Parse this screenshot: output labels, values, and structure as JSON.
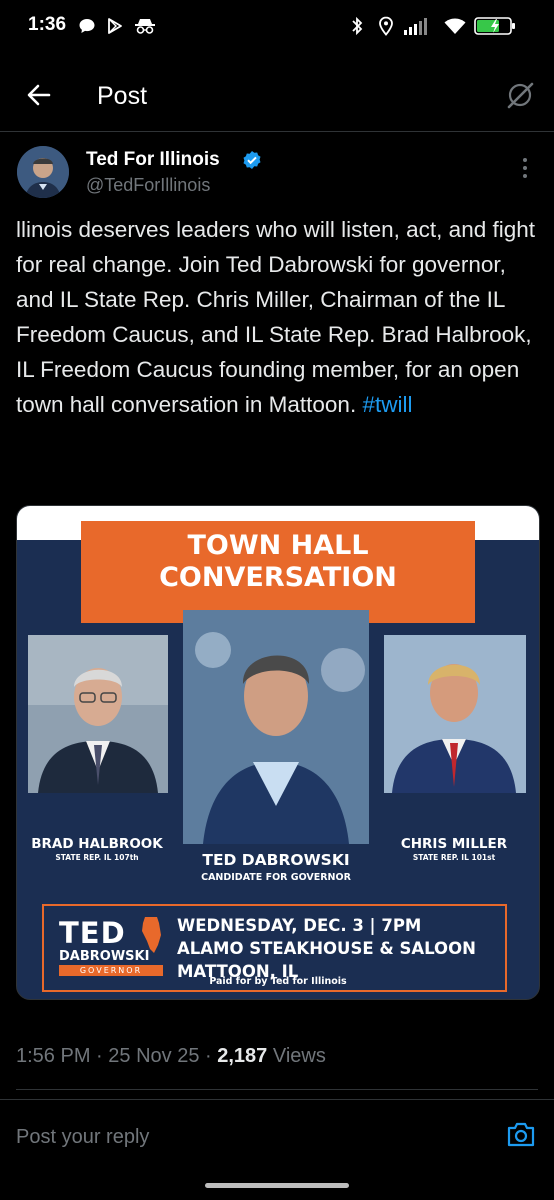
{
  "status_bar": {
    "time": "1:36",
    "left_icons": [
      "chat-bubble-icon",
      "play-store-icon",
      "incognito-icon"
    ],
    "right_icons": [
      "bluetooth-icon",
      "location-icon",
      "signal-icon",
      "wifi-icon",
      "battery-charging-icon"
    ]
  },
  "header": {
    "title": "Post"
  },
  "author": {
    "name": "Ted For Illinois",
    "handle": "@TedForIllinois",
    "verified": true
  },
  "post": {
    "text": "llinois deserves leaders who will listen, act, and fight for real change. Join Ted Dabrowski for governor, and IL State Rep. Chris Miller, Chairman of the IL Freedom Caucus, and IL State Rep. Brad Halbrook, IL Freedom Caucus founding member, for an open town hall conversation in Mattoon.",
    "hashtag": "#twill"
  },
  "flyer": {
    "banner_line1": "TOWN HALL",
    "banner_line2": "CONVERSATION",
    "people": [
      {
        "name": "BRAD HALBROOK",
        "title": "STATE REP.  IL 107th"
      },
      {
        "name": "TED DABROWSKI",
        "title": "CANDIDATE FOR GOVERNOR"
      },
      {
        "name": "CHRIS MILLER",
        "title": "STATE REP.  IL 101st"
      }
    ],
    "logo_ted": "TED",
    "logo_dabrowski": "DABROWSKI",
    "logo_governor": "GOVERNOR",
    "event_line1": "WEDNESDAY, DEC. 3  |  7PM",
    "event_line2": "ALAMO STEAKHOUSE & SALOON",
    "event_line3": "MATTOON, IL",
    "paid_for": "Paid for by Ted for Illinois"
  },
  "meta": {
    "time": "1:56 PM",
    "sep": "·",
    "date": "25 Nov 25",
    "views_count": "2,187",
    "views_label": "Views"
  },
  "reply": {
    "placeholder": "Post your reply"
  },
  "colors": {
    "accent": "#1d9bf0",
    "flyer_navy": "#1b2e52",
    "flyer_orange": "#e8692b"
  }
}
